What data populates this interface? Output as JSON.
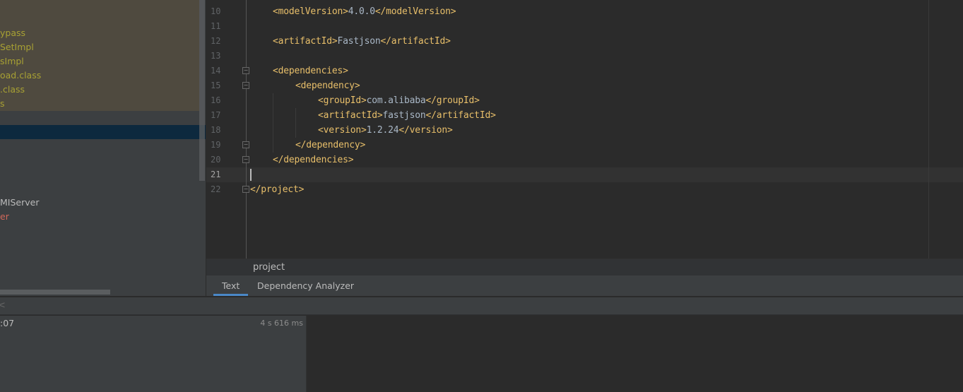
{
  "project_tree": {
    "items_highlighted": [
      "ypass",
      "SetImpl",
      "sImpl",
      "oad.class",
      ".class",
      "s"
    ],
    "item_server": "MIServer",
    "item_error": "er"
  },
  "editor": {
    "lines": [
      {
        "n": "10",
        "indent": 1,
        "parts": [
          [
            "tag",
            "<modelVersion>"
          ],
          [
            "t",
            "4.0.0"
          ],
          [
            "tag",
            "</modelVersion>"
          ]
        ]
      },
      {
        "n": "11",
        "indent": 0,
        "parts": []
      },
      {
        "n": "12",
        "indent": 1,
        "parts": [
          [
            "tag",
            "<artifactId>"
          ],
          [
            "t",
            "Fastjson"
          ],
          [
            "tag",
            "</artifactId>"
          ]
        ]
      },
      {
        "n": "13",
        "indent": 0,
        "parts": []
      },
      {
        "n": "14",
        "indent": 1,
        "parts": [
          [
            "tag",
            "<dependencies>"
          ]
        ],
        "fold": "open"
      },
      {
        "n": "15",
        "indent": 2,
        "parts": [
          [
            "tag",
            "<dependency>"
          ]
        ],
        "fold": "open"
      },
      {
        "n": "16",
        "indent": 3,
        "parts": [
          [
            "tag",
            "<groupId>"
          ],
          [
            "t",
            "com.alibaba"
          ],
          [
            "tag",
            "</groupId>"
          ]
        ]
      },
      {
        "n": "17",
        "indent": 3,
        "parts": [
          [
            "tag",
            "<artifactId>"
          ],
          [
            "t",
            "fastjson"
          ],
          [
            "tag",
            "</artifactId>"
          ]
        ]
      },
      {
        "n": "18",
        "indent": 3,
        "parts": [
          [
            "tag",
            "<version>"
          ],
          [
            "t",
            "1.2.24"
          ],
          [
            "tag",
            "</version>"
          ]
        ]
      },
      {
        "n": "19",
        "indent": 2,
        "parts": [
          [
            "tag",
            "</dependency>"
          ]
        ],
        "fold": "close"
      },
      {
        "n": "20",
        "indent": 1,
        "parts": [
          [
            "tag",
            "</dependencies>"
          ]
        ],
        "fold": "close"
      },
      {
        "n": "21",
        "indent": 0,
        "parts": [],
        "current": true
      },
      {
        "n": "22",
        "indent": 0,
        "parts": [
          [
            "tag",
            "</project>"
          ]
        ],
        "fold": "close"
      }
    ],
    "colors": {
      "tag": "#e8bf6a",
      "text": "#a9b7c6",
      "background": "#2b2b2b"
    }
  },
  "breadcrumb": "project",
  "tabs": [
    {
      "label": "Text",
      "active": true
    },
    {
      "label": "Dependency Analyzer",
      "active": false
    }
  ],
  "bottom": {
    "header_fragment": "<",
    "time_fragment": ":07",
    "duration": "4 s 616 ms"
  }
}
